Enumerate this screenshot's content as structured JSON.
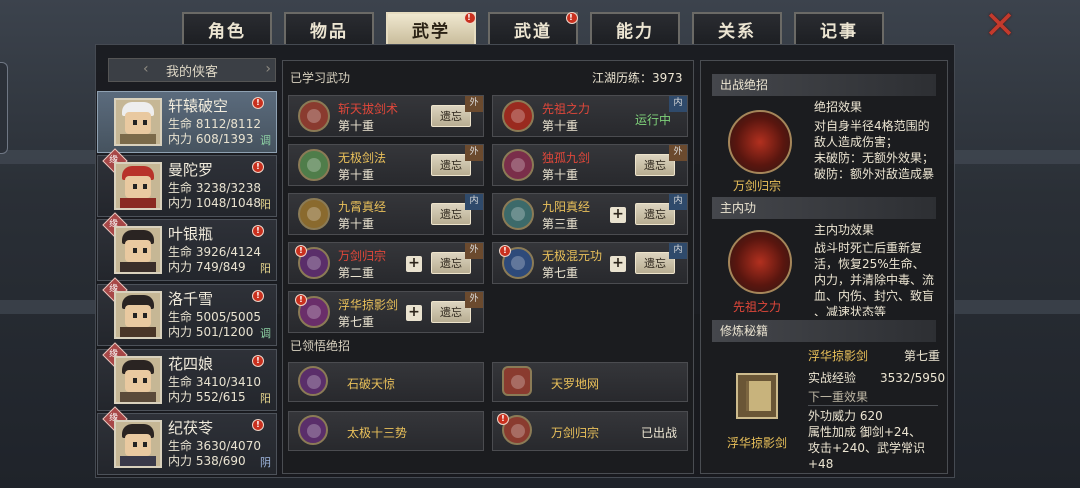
{
  "tabs": [
    {
      "label": "角色",
      "active": false,
      "alert": false
    },
    {
      "label": "物品",
      "active": false,
      "alert": false
    },
    {
      "label": "武学",
      "active": true,
      "alert": true
    },
    {
      "label": "武道",
      "active": false,
      "alert": true
    },
    {
      "label": "能力",
      "active": false,
      "alert": false
    },
    {
      "label": "关系",
      "active": false,
      "alert": false
    },
    {
      "label": "记事",
      "active": false,
      "alert": false
    }
  ],
  "roster": {
    "header": "我的侠客",
    "characters": [
      {
        "name": "轩辕破空",
        "hp_label": "生命",
        "hp": "8112/8112",
        "mp_label": "内力",
        "mp": "608/1393",
        "tag": "调",
        "badge": "",
        "active": true
      },
      {
        "name": "曼陀罗",
        "hp_label": "生命",
        "hp": "3238/3238",
        "mp_label": "内力",
        "mp": "1048/1048",
        "tag": "阳",
        "badge": "缘",
        "active": false
      },
      {
        "name": "叶银瓶",
        "hp_label": "生命",
        "hp": "3926/4124",
        "mp_label": "内力",
        "mp": "749/849",
        "tag": "阳",
        "badge": "缘",
        "active": false
      },
      {
        "name": "洛千雪",
        "hp_label": "生命",
        "hp": "5005/5005",
        "mp_label": "内力",
        "mp": "501/1200",
        "tag": "调",
        "badge": "缘",
        "active": false
      },
      {
        "name": "花四娘",
        "hp_label": "生命",
        "hp": "3410/3410",
        "mp_label": "内力",
        "mp": "552/615",
        "tag": "阳",
        "badge": "缘",
        "active": false
      },
      {
        "name": "纪茯苓",
        "hp_label": "生命",
        "hp": "3630/4070",
        "mp_label": "内力",
        "mp": "538/690",
        "tag": "阴",
        "badge": "缘",
        "active": false
      }
    ]
  },
  "learned": {
    "title": "已学习武功",
    "experience": "江湖历练：3973",
    "skills": [
      {
        "name": "斩天拔剑术",
        "level": "第十重",
        "type": "外",
        "button": "遗忘",
        "name_color": "#e0473a",
        "icon_color": "#8a3b2f"
      },
      {
        "name": "先祖之力",
        "level": "第十重",
        "type": "内",
        "status": "运行中",
        "name_color": "#e0473a",
        "icon_color": "#9a2a1f"
      },
      {
        "name": "无极剑法",
        "level": "第十重",
        "type": "外",
        "button": "遗忘",
        "name_color": "#e9c05a",
        "icon_color": "#4f7d4a"
      },
      {
        "name": "独孤九剑",
        "level": "第十重",
        "type": "外",
        "button": "遗忘",
        "name_color": "#e0473a",
        "icon_color": "#7a2e4a"
      },
      {
        "name": "九霄真经",
        "level": "第十重",
        "type": "内",
        "button": "遗忘",
        "name_color": "#e9c05a",
        "icon_color": "#8a6a2e"
      },
      {
        "name": "九阳真经",
        "level": "第三重",
        "type": "内",
        "button": "遗忘",
        "plus": true,
        "name_color": "#e9c05a",
        "icon_color": "#3c6a6a"
      },
      {
        "name": "万剑归宗",
        "level": "第二重",
        "type": "外",
        "button": "遗忘",
        "plus": true,
        "alert": true,
        "name_color": "#e0473a",
        "icon_color": "#5a2e6a"
      },
      {
        "name": "无极混元功",
        "level": "第七重",
        "type": "内",
        "button": "遗忘",
        "plus": true,
        "alert": true,
        "name_color": "#e9c05a",
        "icon_color": "#2e4a7a"
      },
      {
        "name": "浮华掠影剑",
        "level": "第七重",
        "type": "外",
        "button": "遗忘",
        "plus": true,
        "alert": true,
        "name_color": "#e9c05a",
        "icon_color": "#6a2e6a"
      }
    ]
  },
  "ultimates": {
    "title": "已领悟绝招",
    "items": [
      {
        "name": "石破天惊",
        "status": "",
        "icon_color": "#5a2e6a"
      },
      {
        "name": "天罗地网",
        "status": "",
        "icon_color": "#2e4a7a"
      },
      {
        "name": "太极十三势",
        "status": "",
        "icon_color": "#5a2e6a"
      },
      {
        "name": "万剑归宗",
        "status": "已出战",
        "alert": true,
        "icon_color": "#8a3b2f"
      }
    ]
  },
  "right": {
    "battle": {
      "header": "出战绝招",
      "caption": "万剑归宗",
      "effect_title": "绝招效果",
      "effect_lines": [
        "对自身半径4格范围的",
        "敌人造成伤害；",
        "未破防：无额外效果；",
        "破防：额外对敌造成暴"
      ]
    },
    "internal": {
      "header": "主内功",
      "caption": "先祖之力",
      "effect_title": "主内功效果",
      "effect_lines": [
        "战斗时死亡后重新复",
        "活，恢复25%生命、",
        "内力，并清除中毒、流",
        "血、内伤、封穴、致盲",
        "、减速状态等"
      ]
    },
    "manual": {
      "header": "修炼秘籍",
      "caption": "浮华掠影剑",
      "name": "浮华掠影剑",
      "level": "第七重",
      "exp_label": "实战经验",
      "exp": "3532/5950",
      "next_title": "下一重效果",
      "next_lines": [
        "外功威力 620",
        "属性加成  御剑+24、",
        "攻击+240、武学常识",
        "+48"
      ]
    }
  }
}
